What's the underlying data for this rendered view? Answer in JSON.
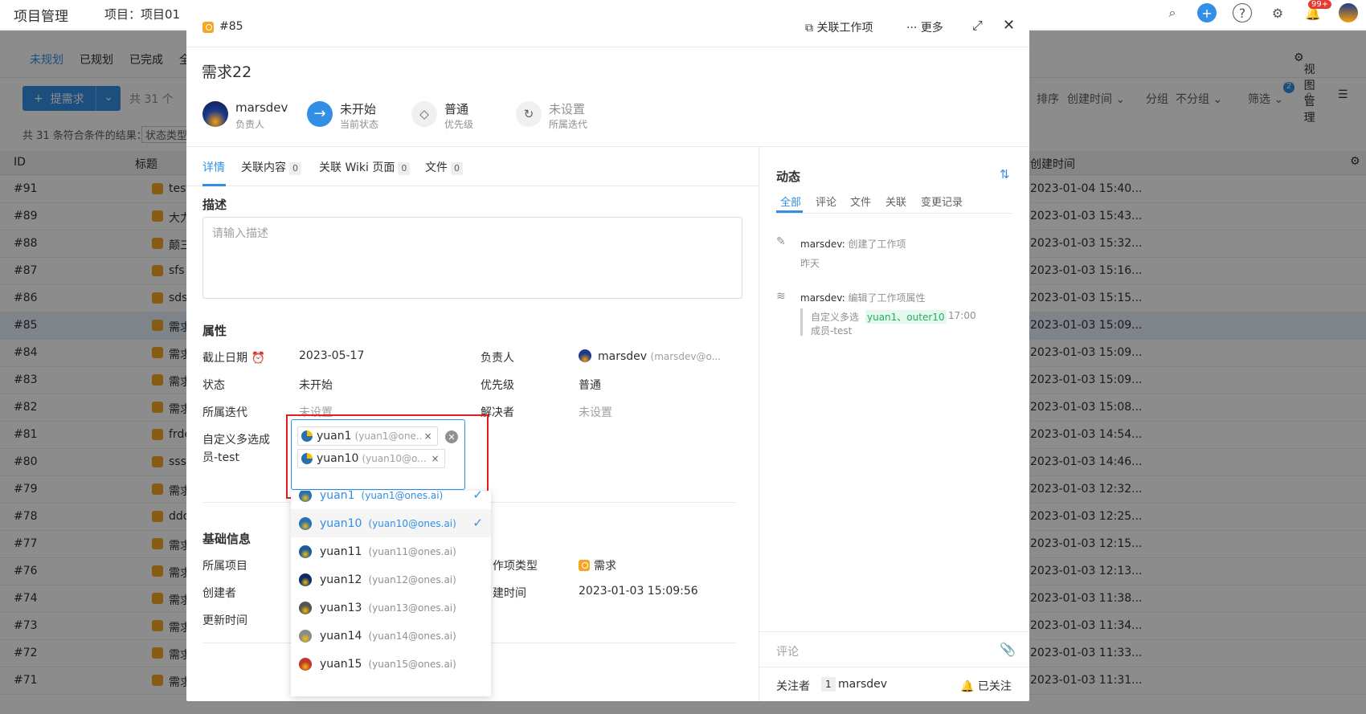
{
  "app": {
    "title": "项目管理",
    "project": "项目：项目01",
    "notif_badge": "99+",
    "tabs": [
      "未规划",
      "已规划",
      "已完成",
      "全"
    ],
    "view_manage": "视图管理",
    "add_button": "提需求",
    "total": "共 31 个",
    "filter_summary": "共 31 条符合条件的结果：",
    "filter_chip": "状态类型",
    "sort_label": "排序",
    "sort_value": "创建时间",
    "group_label": "分组",
    "group_value": "不分组",
    "filter_label": "筛选",
    "filter_badge": "2",
    "col_id": "ID",
    "col_title": "标题",
    "col_created": "创建时间"
  },
  "table": {
    "rows": [
      {
        "id": "#91",
        "title": "test",
        "created": "2023-01-04 15:40..."
      },
      {
        "id": "#89",
        "title": "大力",
        "created": "2023-01-03 15:43..."
      },
      {
        "id": "#88",
        "title": "颠三",
        "created": "2023-01-03 15:32..."
      },
      {
        "id": "#87",
        "title": "sfs",
        "created": "2023-01-03 15:16..."
      },
      {
        "id": "#86",
        "title": "sds",
        "created": "2023-01-03 15:15..."
      },
      {
        "id": "#85",
        "title": "需求",
        "created": "2023-01-03 15:09..."
      },
      {
        "id": "#84",
        "title": "需求",
        "created": "2023-01-03 15:09..."
      },
      {
        "id": "#83",
        "title": "需求",
        "created": "2023-01-03 15:09..."
      },
      {
        "id": "#82",
        "title": "需求",
        "created": "2023-01-03 15:08..."
      },
      {
        "id": "#81",
        "title": "frde",
        "created": "2023-01-03 14:54..."
      },
      {
        "id": "#80",
        "title": "sss",
        "created": "2023-01-03 14:46..."
      },
      {
        "id": "#79",
        "title": "需求",
        "created": "2023-01-03 12:32..."
      },
      {
        "id": "#78",
        "title": "ddd",
        "created": "2023-01-03 12:25..."
      },
      {
        "id": "#77",
        "title": "需求",
        "created": "2023-01-03 12:15..."
      },
      {
        "id": "#76",
        "title": "需求",
        "created": "2023-01-03 12:13..."
      },
      {
        "id": "#74",
        "title": "需求",
        "created": "2023-01-03 11:38..."
      },
      {
        "id": "#73",
        "title": "需求",
        "created": "2023-01-03 11:34..."
      },
      {
        "id": "#72",
        "title": "需求",
        "created": "2023-01-03 11:33..."
      },
      {
        "id": "#71",
        "title": "需求",
        "created": "2023-01-03 11:31..."
      }
    ]
  },
  "modal": {
    "id": "#85",
    "link_work": "关联工作项",
    "more": "更多",
    "title": "需求22",
    "owner": {
      "value": "marsdev",
      "label": "负责人"
    },
    "status": {
      "value": "未开始",
      "label": "当前状态"
    },
    "priority": {
      "value": "普通",
      "label": "优先级"
    },
    "sprint": {
      "value": "未设置",
      "label": "所属迭代"
    },
    "tabs": {
      "detail": "详情",
      "related": "关联内容",
      "related_count": "0",
      "wiki": "关联 Wiki 页面",
      "wiki_count": "0",
      "files": "文件",
      "files_count": "0"
    },
    "desc_heading": "描述",
    "desc_placeholder": "请输入描述",
    "props_heading": "属性",
    "props": {
      "deadline_label": "截止日期",
      "deadline_value": "2023-05-17",
      "assignee_label": "负责人",
      "assignee_name": "marsdev",
      "assignee_email": "(marsdev@o...",
      "status_label": "状态",
      "status_value": "未开始",
      "priority_label": "优先级",
      "priority_value": "普通",
      "sprint_label": "所属迭代",
      "sprint_value": "未设置",
      "resolver_label": "解决者",
      "resolver_value": "未设置",
      "custom_label_1": "自定义多选成",
      "custom_label_2": "员-test"
    },
    "basic_heading": "基础信息",
    "basic": {
      "project_label": "所属项目",
      "creator_label": "创建者",
      "updated_label": "更新时间",
      "type_label": "作项类型",
      "type_value": "需求",
      "created_label": "建时间",
      "created_value": "2023-01-03 15:09:56"
    },
    "selected": [
      {
        "name": "yuan1",
        "email": "(yuan1@one..."
      },
      {
        "name": "yuan10",
        "email": "(yuan10@o..."
      }
    ],
    "options": [
      {
        "name": "yuan1",
        "email": "(yuan1@ones.ai)",
        "color": "#2a6fb3"
      },
      {
        "name": "yuan10",
        "email": "(yuan10@ones.ai)",
        "color": "#2a6fb3"
      },
      {
        "name": "yuan11",
        "email": "(yuan11@ones.ai)",
        "color": "#1e5a9a"
      },
      {
        "name": "yuan12",
        "email": "(yuan12@ones.ai)",
        "color": "#0d2a6b"
      },
      {
        "name": "yuan13",
        "email": "(yuan13@ones.ai)",
        "color": "#555555"
      },
      {
        "name": "yuan14",
        "email": "(yuan14@ones.ai)",
        "color": "#8a8a8a"
      },
      {
        "name": "yuan15",
        "email": "(yuan15@ones.ai)",
        "color": "#c0392b"
      }
    ],
    "activity": {
      "title": "动态",
      "tabs": [
        "全部",
        "评论",
        "文件",
        "关联",
        "变更记录"
      ],
      "item1_user": "marsdev:",
      "item1_action": "创建了工作项",
      "item1_time": "昨天",
      "item2_user": "marsdev:",
      "item2_action": "编辑了工作项属性",
      "item2_field_1": "自定义多选",
      "item2_field_2": "成员-test",
      "item2_value": "yuan1、outer10",
      "item2_time": "17:00"
    },
    "comment_placeholder": "评论",
    "followers_label": "关注者",
    "followers_count": "1",
    "follower_name": "marsdev",
    "followed": "已关注"
  }
}
